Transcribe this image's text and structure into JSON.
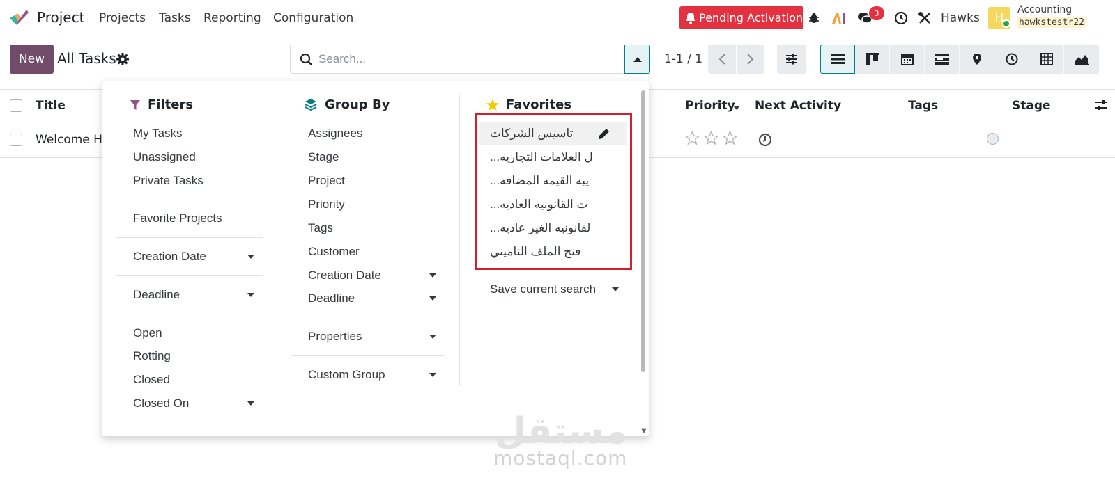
{
  "navbar": {
    "app_name": "Project",
    "menu": [
      "Projects",
      "Tasks",
      "Reporting",
      "Configuration"
    ],
    "pending_label": "Pending Activation",
    "messages_count": "3",
    "user_name": "Hawks",
    "avatar_letter": "H",
    "company": "Accounting",
    "database": "hawkstestr22"
  },
  "control_panel": {
    "new_label": "New",
    "breadcrumb": "All Tasks",
    "search_placeholder": "Search...",
    "pager": "1-1 / 1"
  },
  "table": {
    "headers": {
      "title": "Title",
      "priority": "Priority",
      "next_activity": "Next Activity",
      "tags": "Tags",
      "stage": "Stage"
    },
    "rows": [
      {
        "title": "Welcome Ha"
      }
    ]
  },
  "search_panel": {
    "filters": {
      "title": "Filters",
      "items": [
        "My Tasks",
        "Unassigned",
        "Private Tasks",
        "Favorite Projects",
        "Creation Date",
        "Deadline",
        "Open",
        "Rotting",
        "Closed",
        "Closed On"
      ]
    },
    "group_by": {
      "title": "Group By",
      "items": [
        "Assignees",
        "Stage",
        "Project",
        "Priority",
        "Tags",
        "Customer",
        "Creation Date",
        "Deadline",
        "Properties",
        "Custom Group"
      ]
    },
    "favorites": {
      "title": "Favorites",
      "items": [
        "تاسيس الشركات",
        "...ل العلامات التجاريه",
        "...يبه القيمه المضافه",
        "...ت القانونيه العاديه",
        "...لقانونيه الغير عاديه",
        "فتح الملف التاميني"
      ],
      "save_label": "Save current search"
    }
  },
  "watermark": {
    "arabic": "مستقل",
    "latin": "mostaql.com"
  },
  "colors": {
    "brand": "#714b67",
    "accent": "#017e84",
    "danger": "#e4313f",
    "highlight_border": "#d3202a"
  }
}
